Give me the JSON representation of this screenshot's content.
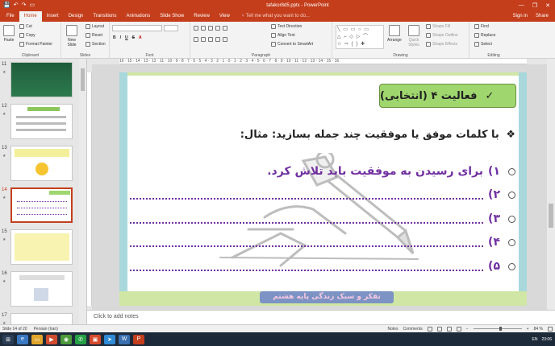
{
  "window": {
    "title": "tafakor8d5.pptx - PowerPoint",
    "minimize": "—",
    "restore": "❐",
    "close": "✕"
  },
  "qat": {
    "save": "💾",
    "undo": "↶",
    "redo": "↷",
    "present": "▭"
  },
  "tabs": [
    {
      "label": "File"
    },
    {
      "label": "Home"
    },
    {
      "label": "Insert"
    },
    {
      "label": "Design"
    },
    {
      "label": "Transitions"
    },
    {
      "label": "Animations"
    },
    {
      "label": "Slide Show"
    },
    {
      "label": "Review"
    },
    {
      "label": "View"
    }
  ],
  "tell_me": "♀ Tell me what you want to do...",
  "account": {
    "signin": "Sign in",
    "share": "Share"
  },
  "ribbon": {
    "clipboard": {
      "paste": "Paste",
      "cut": "Cut",
      "copy": "Copy",
      "format_painter": "Format Painter",
      "label": "Clipboard"
    },
    "slides": {
      "new_slide": "New Slide",
      "layout": "Layout",
      "reset": "Reset",
      "section": "Section",
      "label": "Slides"
    },
    "font": {
      "label": "Font",
      "bold": "B",
      "italic": "I",
      "underline": "U",
      "strike": "S",
      "aa": "A"
    },
    "paragraph": {
      "text_direction": "Text Direction",
      "align_text": "Align Text",
      "convert_smartart": "Convert to SmartArt",
      "label": "Paragraph"
    },
    "drawing": {
      "arrange": "Arrange",
      "quick_styles": "Quick Styles",
      "shape_fill": "Shape Fill",
      "shape_outline": "Shape Outline",
      "shape_effects": "Shape Effects",
      "label": "Drawing"
    },
    "editing": {
      "find": "Find",
      "replace": "Replace",
      "select": "Select",
      "label": "Editing"
    }
  },
  "thumbnails": [
    {
      "num": "11",
      "star": "★"
    },
    {
      "num": "12",
      "star": "★"
    },
    {
      "num": "13",
      "star": "★"
    },
    {
      "num": "14",
      "star": "★"
    },
    {
      "num": "15",
      "star": "★"
    },
    {
      "num": "16",
      "star": "★"
    },
    {
      "num": "17",
      "star": "★"
    }
  ],
  "ruler_text": "16 · 15 · 14 · 13 · 12 · 11 · 10 · 9 · 8 · 7 · 6 · 5 · 4 · 3 · 2 · 1 · 0 · 1 · 2 · 3 · 4 · 5 · 6 · 7 · 8 · 9 · 10 · 11 · 12 · 13 · 14 · 15 · 16",
  "slide": {
    "heading": "فعالیت ۴ (انتخابی)",
    "heading_check": "✓",
    "prompt_bullet": "❖",
    "prompt": "با کلمات موفق یا موفقیت چند جمله بسازید: مثال:",
    "lines": [
      {
        "num": "۱)",
        "text": "برای رسیدن به موفقیت باید تلاش کرد."
      },
      {
        "num": "۲)",
        "text": ""
      },
      {
        "num": "۳)",
        "text": ""
      },
      {
        "num": "۴)",
        "text": ""
      },
      {
        "num": "۵)",
        "text": ""
      }
    ],
    "footer": "تفکر و سبک زندگی پایه هشتم"
  },
  "notes_placeholder": "Click to add notes",
  "status": {
    "slide_info": "Slide 14 of 20",
    "language": "Persian (Iran)",
    "notes": "Notes",
    "comments": "Comments",
    "zoom": "84 %"
  },
  "taskbar": {
    "clock": "23:06",
    "lang": "EN"
  },
  "colors": {
    "accent": "#c43e1c",
    "heading_box": "#9fd66e",
    "purple_text": "#7030a0",
    "slide_frame": "#a8d8dc"
  }
}
